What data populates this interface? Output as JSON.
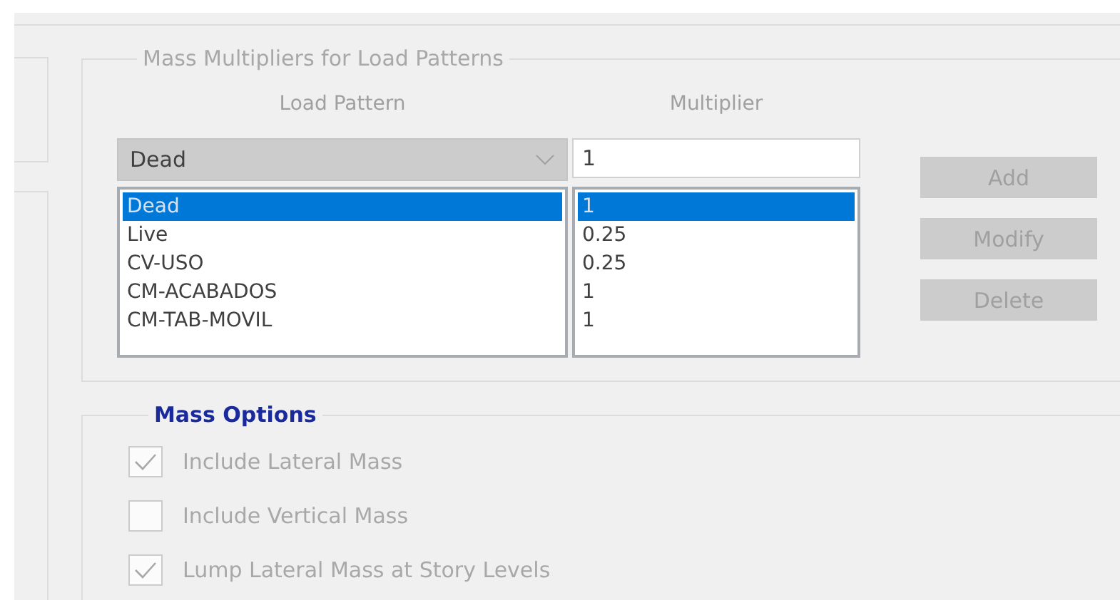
{
  "mass_multipliers": {
    "title": "Mass Multipliers for Load Patterns",
    "columns": [
      "Load Pattern",
      "Multiplier"
    ],
    "load_pattern_combo": {
      "value": "Dead"
    },
    "multiplier_field": {
      "value": "1"
    },
    "rows": [
      {
        "pattern": "Dead",
        "multiplier": "1",
        "selected": true
      },
      {
        "pattern": "Live",
        "multiplier": "0.25",
        "selected": false
      },
      {
        "pattern": "CV-USO",
        "multiplier": "0.25",
        "selected": false
      },
      {
        "pattern": "CM-ACABADOS",
        "multiplier": "1",
        "selected": false
      },
      {
        "pattern": "CM-TAB-MOVIL",
        "multiplier": "1",
        "selected": false
      }
    ],
    "buttons": [
      {
        "label": "Add",
        "disabled": true
      },
      {
        "label": "Modify",
        "disabled": true
      },
      {
        "label": "Delete",
        "disabled": true
      }
    ]
  },
  "mass_options": {
    "title": "Mass Options",
    "options": [
      {
        "label": "Include Lateral Mass",
        "checked": true,
        "disabled": true
      },
      {
        "label": "Include Vertical Mass",
        "checked": false,
        "disabled": true
      },
      {
        "label": "Lump Lateral Mass at Story Levels",
        "checked": true,
        "disabled": true
      }
    ]
  }
}
